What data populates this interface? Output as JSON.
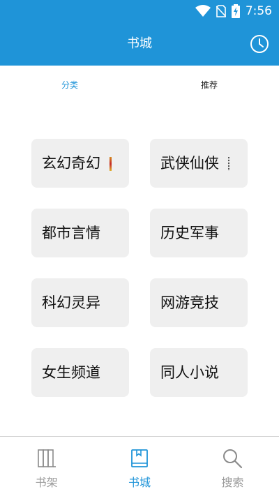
{
  "status_bar": {
    "time": "7:56",
    "icons": [
      "wifi-icon",
      "no-sim-icon",
      "battery-charging-icon"
    ]
  },
  "header": {
    "title": "书城",
    "history_icon": "clock-icon"
  },
  "tabs": [
    {
      "label": "分类",
      "active": true
    },
    {
      "label": "推荐",
      "active": false
    }
  ],
  "categories": [
    {
      "label": "玄幻奇幻"
    },
    {
      "label": "武侠仙侠"
    },
    {
      "label": "都市言情"
    },
    {
      "label": "历史军事"
    },
    {
      "label": "科幻灵异"
    },
    {
      "label": "网游竞技"
    },
    {
      "label": "女生频道"
    },
    {
      "label": "同人小说"
    }
  ],
  "bottom_nav": [
    {
      "label": "书架",
      "icon": "books-icon",
      "active": false
    },
    {
      "label": "书城",
      "icon": "bookstore-icon",
      "active": true
    },
    {
      "label": "搜索",
      "icon": "search-icon",
      "active": false
    }
  ],
  "colors": {
    "primary": "#1f94d8",
    "card_bg": "#efefef",
    "inactive": "#9a9a9a"
  }
}
